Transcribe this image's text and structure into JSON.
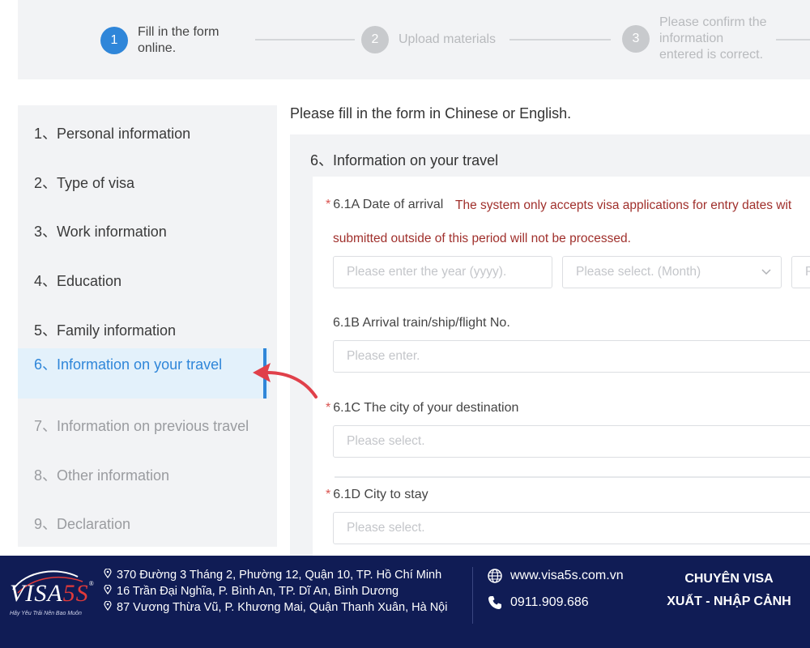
{
  "stepper": {
    "steps": [
      {
        "number": "1",
        "label_line1": "Fill in the form",
        "label_line2": "online.",
        "state": "active"
      },
      {
        "number": "2",
        "label_line1": "Upload materials",
        "label_line2": "",
        "state": "inactive"
      },
      {
        "number": "3",
        "label_line1": "Please confirm the",
        "label_line2": "information",
        "label_line3": "entered is correct.",
        "state": "inactive"
      }
    ]
  },
  "sidebar": {
    "items": [
      {
        "label": "1、Personal information",
        "state": "done"
      },
      {
        "label": "2、Type of visa",
        "state": "done"
      },
      {
        "label": "3、Work information",
        "state": "done"
      },
      {
        "label": "4、Education",
        "state": "done"
      },
      {
        "label": "5、Family information",
        "state": "done"
      },
      {
        "label": "6、Information on your travel",
        "state": "active"
      },
      {
        "label": "7、Information on previous travel",
        "state": "pending"
      },
      {
        "label": "8、Other information",
        "state": "pending"
      },
      {
        "label": "9、Declaration",
        "state": "pending"
      }
    ]
  },
  "main": {
    "note": "Please fill in the form in Chinese or English.",
    "section_title": "6、Information on your travel",
    "fields": {
      "arrival_date": {
        "required": "*",
        "label": "6.1A Date of arrival",
        "warning_line1": "The system only accepts visa applications for entry dates wit",
        "warning_line2": "submitted outside of this period will not be processed.",
        "year_placeholder": "Please enter the year (yyyy).",
        "month_placeholder": "Please select. (Month)",
        "day_placeholder_partial": "P"
      },
      "arrival_flight": {
        "label": "6.1B Arrival train/ship/flight No.",
        "placeholder": "Please enter."
      },
      "destination_city": {
        "required": "*",
        "label": "6.1C The city of your destination",
        "placeholder": "Please select."
      },
      "city_to_stay": {
        "required": "*",
        "label": "6.1D City to stay",
        "placeholder": "Please select."
      }
    }
  },
  "footer": {
    "logo": {
      "text_a": "VISA",
      "text_b": "5S",
      "registered": "®",
      "tagline": "Hãy Yêu Trải Nên Bao Muôn"
    },
    "addresses": [
      "370 Đường 3 Tháng 2, Phường 12, Quận 10, TP. Hồ Chí Minh",
      "16 Trần Đại Nghĩa, P. Bình An, TP. Dĩ An, Bình Dương",
      "87 Vương Thừa Vũ, P. Khương Mai, Quận Thanh Xuân, Hà Nội"
    ],
    "website": "www.visa5s.com.vn",
    "phone": "0911.909.686",
    "slogan_line1": "CHUYÊN VISA",
    "slogan_line2": "XUẤT - NHẬP CẢNH"
  },
  "colors": {
    "accent": "#2f86d9",
    "warning": "#a0302c",
    "footer_bg": "#101c55",
    "arrow": "#e0404a"
  },
  "icons": [
    "location-pin-icon",
    "globe-icon",
    "phone-icon",
    "chevron-down-icon",
    "red-arrow-annotation"
  ]
}
